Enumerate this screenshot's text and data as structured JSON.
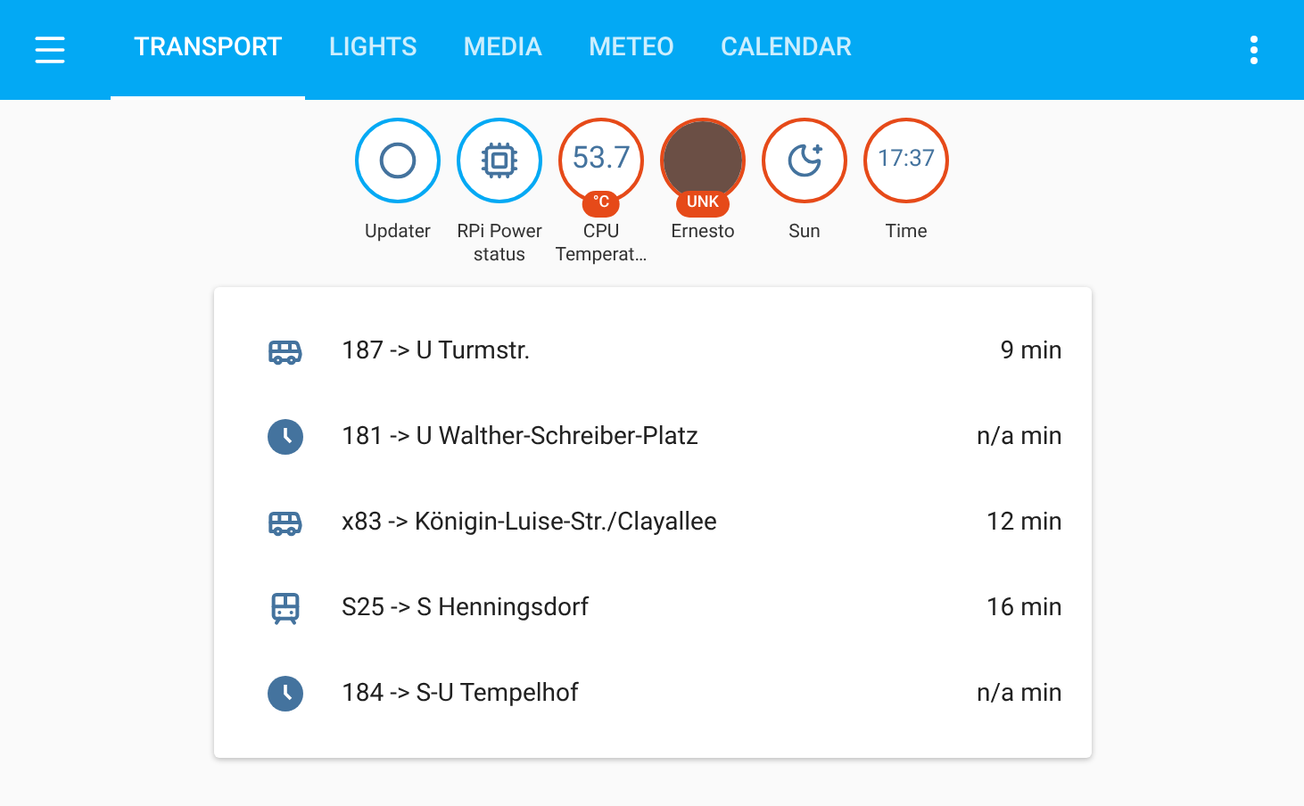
{
  "tabs": [
    {
      "label": "TRANSPORT",
      "selected": true
    },
    {
      "label": "LIGHTS",
      "selected": false
    },
    {
      "label": "MEDIA",
      "selected": false
    },
    {
      "label": "METEO",
      "selected": false
    },
    {
      "label": "CALENDAR",
      "selected": false
    }
  ],
  "badges": [
    {
      "kind": "ring",
      "label": "Updater",
      "color": "#03a9f4"
    },
    {
      "kind": "board",
      "label": "RPi Power status",
      "color": "#03a9f4"
    },
    {
      "kind": "text",
      "value": "53.7",
      "chip": "°C",
      "label": "CPU Temperat…",
      "color": "#e64a19"
    },
    {
      "kind": "photo",
      "chip": "UNK",
      "label": "Ernesto",
      "color": "#e64a19"
    },
    {
      "kind": "moon",
      "label": "Sun",
      "color": "#e64a19"
    },
    {
      "kind": "text",
      "value": "17:37",
      "label": "Time",
      "color": "#e64a19"
    }
  ],
  "departures": [
    {
      "kind": "bus",
      "line": "187 -> U Turmstr.",
      "time": "9 min"
    },
    {
      "kind": "clock",
      "line": "181 -> U Walther-Schreiber-Platz",
      "time": "n/a min"
    },
    {
      "kind": "bus",
      "line": "x83 -> Königin-Luise-Str./Clayallee",
      "time": "12 min"
    },
    {
      "kind": "train",
      "line": "S25 -> S Henningsdorf",
      "time": "16 min"
    },
    {
      "kind": "clock",
      "line": "184 -> S-U Tempelhof",
      "time": "n/a min"
    }
  ]
}
